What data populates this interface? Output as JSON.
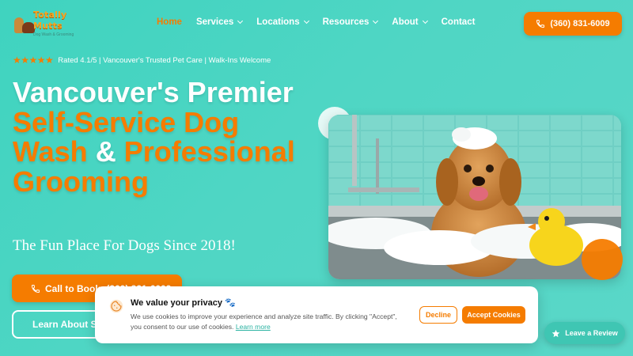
{
  "logo": {
    "line1": "Totally",
    "line2": "Mutts",
    "tagline": "Dog Wash & Grooming"
  },
  "nav": {
    "items": [
      {
        "label": "Home",
        "active": true,
        "dropdown": false
      },
      {
        "label": "Services",
        "active": false,
        "dropdown": true
      },
      {
        "label": "Locations",
        "active": false,
        "dropdown": true
      },
      {
        "label": "Resources",
        "active": false,
        "dropdown": true
      },
      {
        "label": "About",
        "active": false,
        "dropdown": true
      },
      {
        "label": "Contact",
        "active": false,
        "dropdown": false
      }
    ],
    "phone_label": "(360) 831-6009"
  },
  "rating": {
    "stars": "★★★★★",
    "value": 4.1,
    "text": "Rated 4.1/5 | Vancouver's Trusted Pet Care | Walk-Ins Welcome"
  },
  "hero": {
    "headline_part1": "Vancouver's Premier ",
    "headline_part2": "Self-Service Dog Wash",
    "headline_part3": " & ",
    "headline_part4": "Professional Grooming",
    "subhead": "The Fun Place For Dogs Since 2018!",
    "cta_book": "Call to Book: (360) 831-6009",
    "cta_learn": "Learn About Services"
  },
  "cookie": {
    "title": "We value your privacy 🐾",
    "text": "We use cookies to improve your experience and analyze site traffic. By clicking \"Accept\", you consent to our use of cookies.",
    "learn_more": "Learn more",
    "decline": "Decline",
    "accept": "Accept Cookies"
  },
  "review": {
    "label": "Leave a Review"
  },
  "colors": {
    "accent": "#f57c00",
    "teal": "#4fd6c4"
  }
}
